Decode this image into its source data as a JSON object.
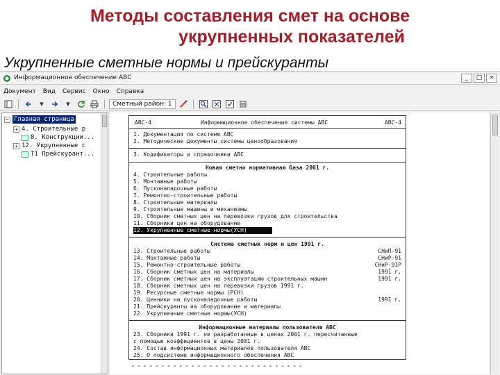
{
  "slide": {
    "title_line1": "Методы составления смет на основе",
    "title_line2": "укрупненных показателей",
    "subtitle": "Укрупненные сметные нормы и прейскуранты"
  },
  "window": {
    "title": "Информационное обеспечение АВС",
    "buttons": [
      "_",
      "□",
      "×"
    ]
  },
  "menu": [
    "Документ",
    "Вид",
    "Сервис",
    "Окно",
    "Справка"
  ],
  "toolbar": {
    "region_label": "Сметный район: 1",
    "icons": [
      "back-icon",
      "forward-icon",
      "refresh-icon",
      "print-icon",
      "find-icon",
      "bookmark-icon",
      "info-icon"
    ]
  },
  "tree": {
    "root": "Главная страница",
    "items": [
      {
        "label": "4. Строительные р",
        "expander": "+"
      },
      {
        "label": "8. Конструкции...",
        "expander": ""
      },
      {
        "label": "12. Укрупненные с",
        "expander": "+"
      },
      {
        "label": "Т1 Прейскурант...",
        "expander": ""
      }
    ]
  },
  "doc": {
    "header_left": "АВС-4",
    "header_center": "Информационное обеспечение системы АВС",
    "header_right": "АВС-4",
    "section0": [
      "1. Документация по системе АВС",
      "2. Методические документы системы ценообразования"
    ],
    "section0b": [
      "3. Кодификаторы и справочники АВС"
    ],
    "section1_title": "Новая сметно нормативная база 2001 г.",
    "section1": [
      "4. Строительные работы",
      "5. Монтажные работы",
      "6. Пусконаладочные работы",
      "7. Ремонтно-строительные работы",
      "8. Строительные материалы",
      "9. Строительные машины и механизмы",
      "10. Сборник сметных цен на перевозки грузов для строительства",
      "11. Сборники цен на оборудование",
      "12. Укрупненные сметные нормы(УСН)"
    ],
    "section2_title": "Система сметных норм и цен 1991 г.",
    "section2": [
      {
        "text": "13. Строительные работы",
        "code": "СНиП-91"
      },
      {
        "text": "14. Монтажные работы",
        "code": "СНиР-91"
      },
      {
        "text": "15. Ремонтно-строительные работы",
        "code": "СНиР-91Р"
      },
      {
        "text": "16. Сборник сметных цен на материалы",
        "code": "1991 г."
      },
      {
        "text": "17. Сборник сметных цен на эксплуатацию строительных машин",
        "code": "1991 г."
      },
      {
        "text": "18. Сборник сметных цен на перевозки грузов 1991 г.",
        "code": ""
      },
      {
        "text": "19. Ресурсные сметные нормы (РСН)",
        "code": ""
      },
      {
        "text": "20. Ценники на пусконаладочные работы",
        "code": "1991 г."
      },
      {
        "text": "21. Прейскуранты на оборудование и материалы",
        "code": ""
      },
      {
        "text": "22. Укрупненные сметные нормы(УСН)",
        "code": ""
      }
    ],
    "section3_title": "Информационные материалы пользователя АВС",
    "section3": [
      "23. Сборники 1991 г. не разработанные в ценах 2001 г. пересчитанные",
      "    с помощью коэффициентов в цены 2001 г.",
      "24. Состав информационных материалов пользователя АВС",
      "25. О подсистеме информационного обеспечения АВС"
    ],
    "footer_dashes": "-----------------------------"
  }
}
